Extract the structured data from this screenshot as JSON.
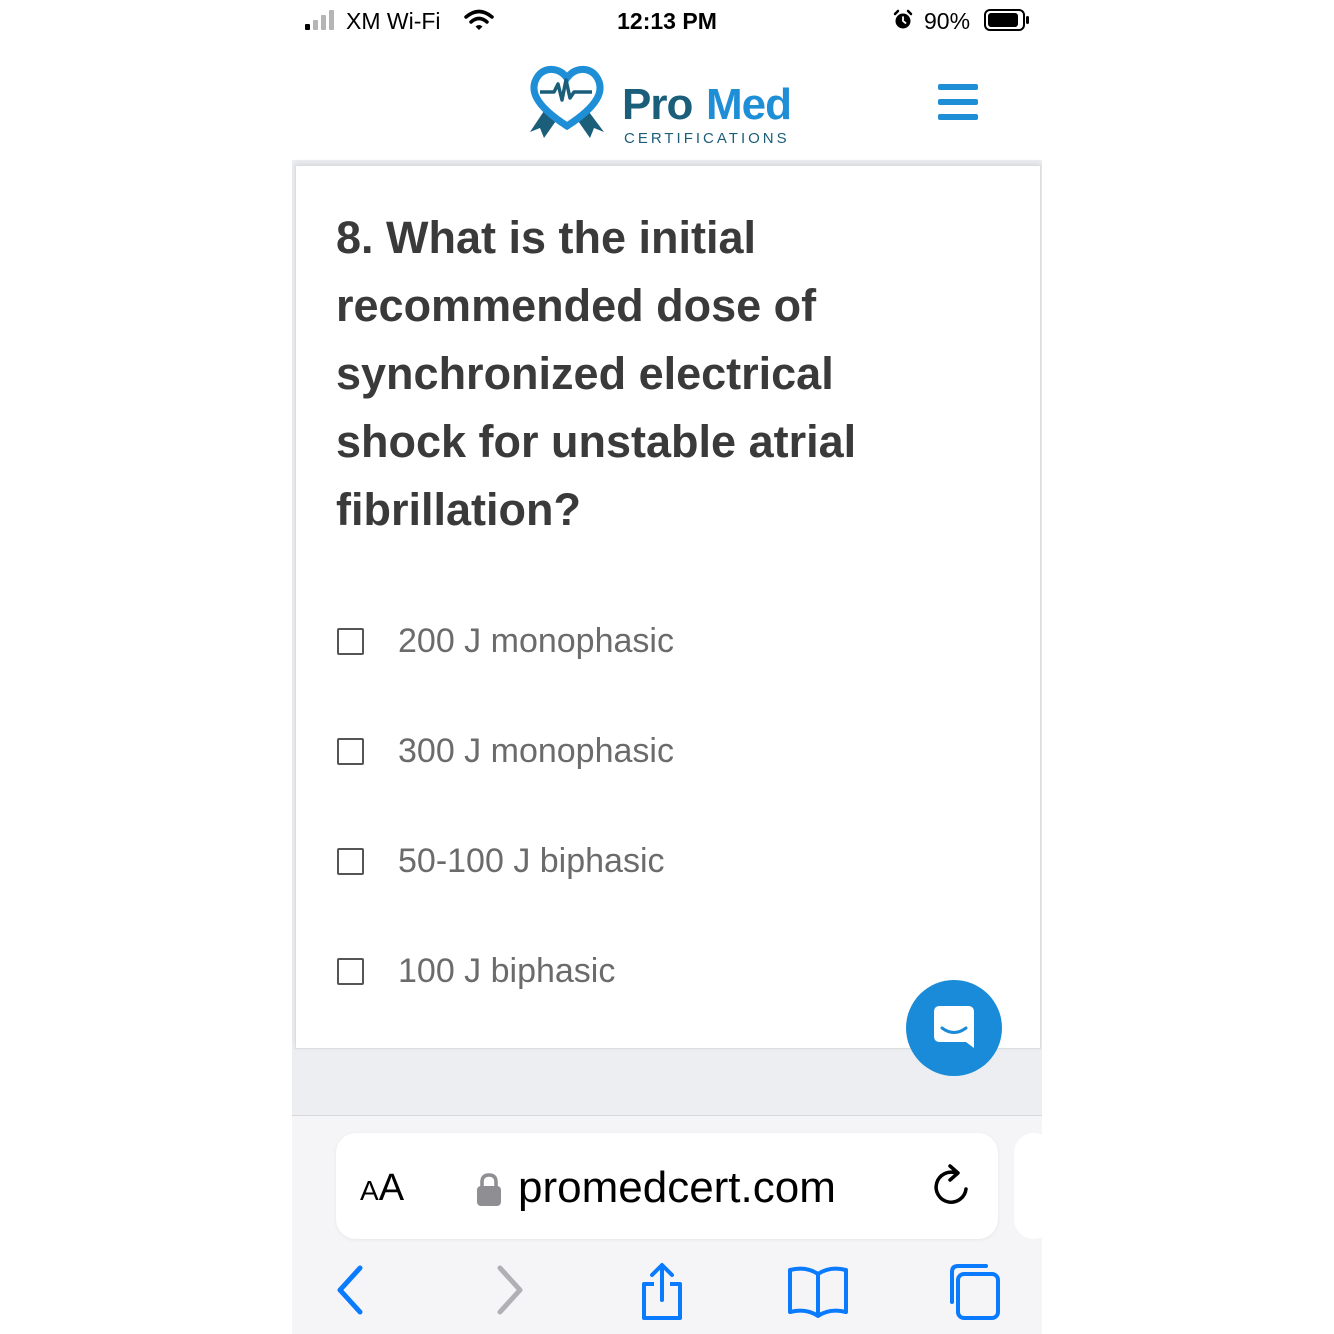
{
  "status_bar": {
    "carrier": "XM Wi-Fi",
    "time": "12:13 PM",
    "battery_percent": "90%",
    "signal_bars": 1,
    "battery_level": 0.9
  },
  "header": {
    "logo_pro": "Pro",
    "logo_med": "Med",
    "logo_sub": "CERTIFICATIONS",
    "brand_dark": "#1a5e7a",
    "brand_blue": "#1e8fd6"
  },
  "question": {
    "text": "8. What is the initial recommended dose of synchronized electrical shock for unstable atrial fibrillation?",
    "options": [
      {
        "label": "200 J monophasic",
        "checked": false
      },
      {
        "label": "300 J monophasic",
        "checked": false
      },
      {
        "label": "50-100 J biphasic",
        "checked": false
      },
      {
        "label": "100 J biphasic",
        "checked": false
      }
    ]
  },
  "chat": {
    "icon": "chat-icon",
    "color": "#1a8bd8"
  },
  "browser": {
    "text_size_button": {
      "small": "A",
      "large": "A"
    },
    "url": "promedcert.com",
    "icons": [
      "back-icon",
      "forward-icon",
      "share-icon",
      "bookmarks-icon",
      "tabs-icon"
    ],
    "accent": "#0a7aff"
  }
}
